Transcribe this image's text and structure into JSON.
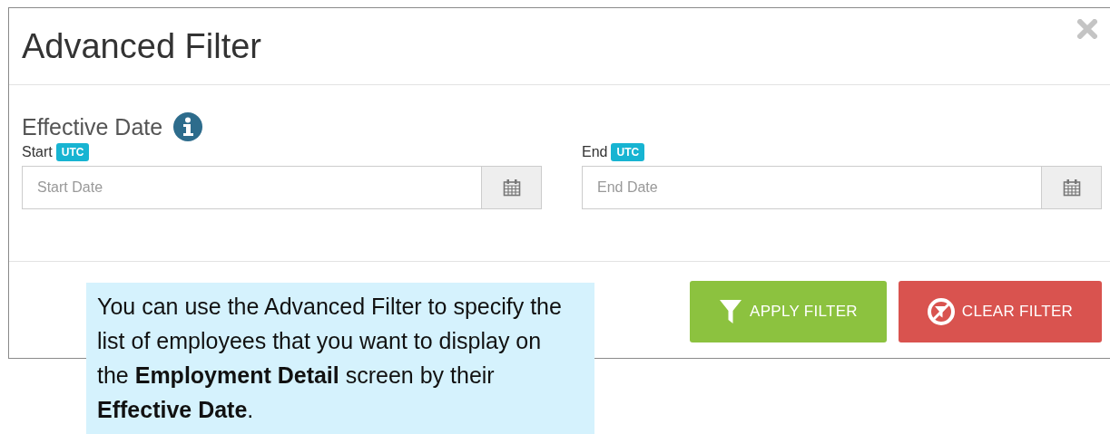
{
  "dialog": {
    "title": "Advanced Filter"
  },
  "section": {
    "title": "Effective Date"
  },
  "fields": [
    {
      "label": "Start",
      "badge": "UTC",
      "placeholder": "Start Date"
    },
    {
      "label": "End",
      "badge": "UTC",
      "placeholder": "End Date"
    }
  ],
  "buttons": [
    {
      "label": "APPLY FILTER",
      "kind": "apply"
    },
    {
      "label": "CLEAR FILTER",
      "kind": "clear"
    }
  ],
  "callout": {
    "text": "You can use the Advanced Filter to specify the list of employees that you want to display on the **Employment Detail** screen by their **Effective Date**."
  }
}
